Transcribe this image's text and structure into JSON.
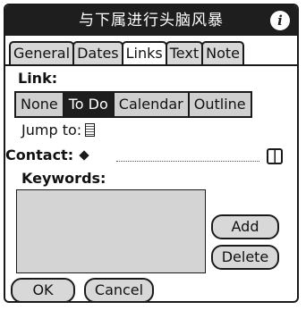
{
  "window": {
    "title": "与下属进行头脑风暴",
    "info_glyph": "i"
  },
  "tabs": [
    {
      "label": "General",
      "active": false
    },
    {
      "label": "Dates",
      "active": false
    },
    {
      "label": "Links",
      "active": true
    },
    {
      "label": "Text",
      "active": false
    },
    {
      "label": "Note",
      "active": false
    }
  ],
  "link": {
    "label": "Link:",
    "options": [
      {
        "label": "None",
        "selected": false
      },
      {
        "label": "To Do",
        "selected": true
      },
      {
        "label": "Calendar",
        "selected": false
      },
      {
        "label": "Outline",
        "selected": false
      }
    ],
    "jump_label": "Jump to:"
  },
  "contact": {
    "label": "Contact:"
  },
  "keywords": {
    "label": "Keywords:"
  },
  "buttons": {
    "add": "Add",
    "delete": "Delete",
    "ok": "OK",
    "cancel": "Cancel"
  },
  "icons": {
    "info": "info-icon",
    "jump": "document-icon",
    "contact_marker": "diamond-icon",
    "contact_lookup": "address-book-icon"
  },
  "colors": {
    "titlebar": "#1e1e1e",
    "selected_segment": "#1e1e1e",
    "control_fill": "#d8d8d8",
    "keywords_fill": "#d4d4d4"
  }
}
